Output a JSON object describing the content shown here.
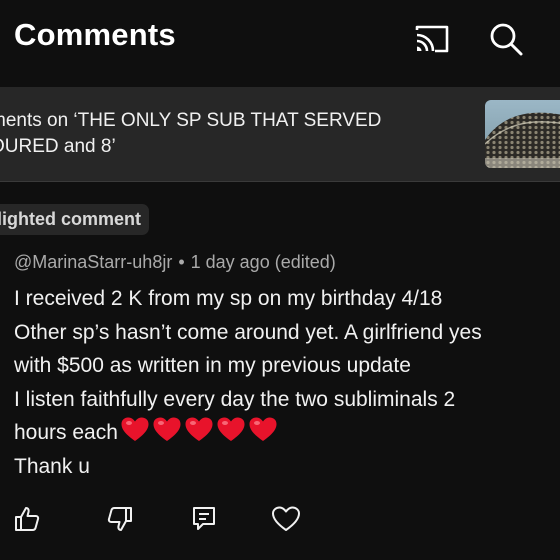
{
  "header": {
    "title": "Comments",
    "cast_icon": "cast-icon",
    "search_icon": "search-icon"
  },
  "video": {
    "title": "ments on ‘THE ONLY SP SUB THAT SERVED\nOURED and 8’",
    "thumbnail": "video-thumbnail"
  },
  "comment": {
    "highlight_label": "nlighted comment",
    "author": "@MarinaStarr-uh8jr",
    "separator": "•",
    "time": "1 day ago (edited)",
    "lines": [
      "I received 2 K from my sp on my birthday 4/18",
      "Other sp’s hasn’t come around yet. A girlfriend yes",
      "with $500 as written in my previous update",
      "I listen faithfully every day the two subliminals 2",
      "hours each",
      "Thank u"
    ],
    "hearts": 5
  },
  "actions": {
    "like_icon": "thumbs-up-icon",
    "dislike_icon": "thumbs-down-icon",
    "reply_icon": "reply-icon",
    "heart_icon": "heart-icon"
  },
  "colors": {
    "background": "#0f0f0f",
    "strip": "#272727",
    "text": "#f1f1f1",
    "meta": "#aaaaaa",
    "heart": "#e8132b"
  }
}
